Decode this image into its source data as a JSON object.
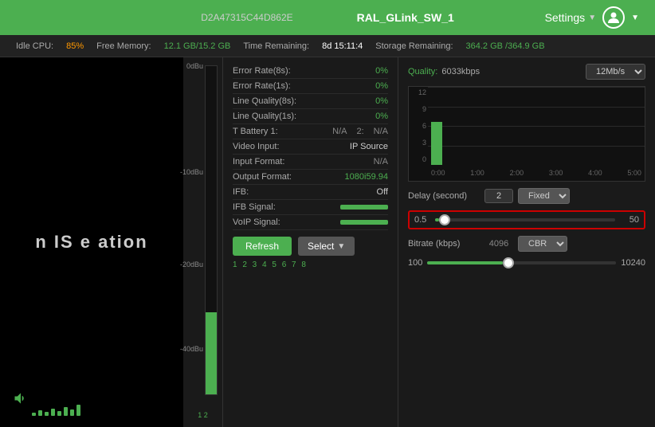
{
  "header": {
    "device_id": "D2A47315C44D862E",
    "link_name": "RAL_GLink_SW_1",
    "settings_label": "Settings",
    "chevron": "▼"
  },
  "status_bar": {
    "idle_cpu_label": "Idle CPU:",
    "idle_cpu_value": "85%",
    "free_memory_label": "Free Memory:",
    "free_memory_value": "12.1 GB/15.2 GB",
    "time_remaining_label": "Time Remaining:",
    "time_remaining_value": "8d 15:11:4",
    "storage_remaining_label": "Storage Remaining:",
    "storage_remaining_value": "364.2 GB /364.9 GB"
  },
  "video_panel": {
    "text": "n IS  e  ation"
  },
  "meter": {
    "labels": [
      "0dBu",
      "-10dBu",
      "-20dBu",
      "-40dBu"
    ],
    "numbers": "1 2 3 4 5 6 7 8"
  },
  "stats": {
    "rows": [
      {
        "key": "Error Rate(8s):",
        "val": "0%",
        "type": "green"
      },
      {
        "key": "Error Rate(1s):",
        "val": "0%",
        "type": "green"
      },
      {
        "key": "Line Quality(8s):",
        "val": "0%",
        "type": "green"
      },
      {
        "key": "Line Quality(1s):",
        "val": "0%",
        "type": "green"
      }
    ],
    "battery_label": "T Battery 1:",
    "battery_val1": "N/A",
    "battery_num": "2:",
    "battery_val2": "N/A",
    "video_input_label": "Video Input:",
    "video_input_val": "IP Source",
    "input_format_label": "Input Format:",
    "input_format_val": "N/A",
    "output_format_label": "Output Format:",
    "output_format_val": "1080i59.94",
    "ifb_label": "IFB:",
    "ifb_val": "Off",
    "ifb_signal_label": "IFB Signal:",
    "voip_signal_label": "VoIP Signal:",
    "refresh_label": "Refresh",
    "select_label": "Select"
  },
  "quality": {
    "label": "Quality:",
    "quality_value": "6033kbps",
    "dropdown_value": "12Mb/s",
    "chart": {
      "y_labels": [
        "12",
        "9",
        "6",
        "3",
        "0"
      ],
      "x_labels": [
        "0:00",
        "1:00",
        "2:00",
        "3:00",
        "4:00",
        "5:00"
      ],
      "bar_height_pct": 55
    }
  },
  "delay": {
    "label": "Delay (second)",
    "value": "2",
    "mode": "Fixed",
    "slider_min": "0.5",
    "slider_max": "50",
    "chevron": "▼"
  },
  "bitrate": {
    "label": "Bitrate (kbps)",
    "value": "4096",
    "mode": "CBR",
    "slider_min": "100",
    "slider_max": "10240",
    "chevron": "▼"
  }
}
